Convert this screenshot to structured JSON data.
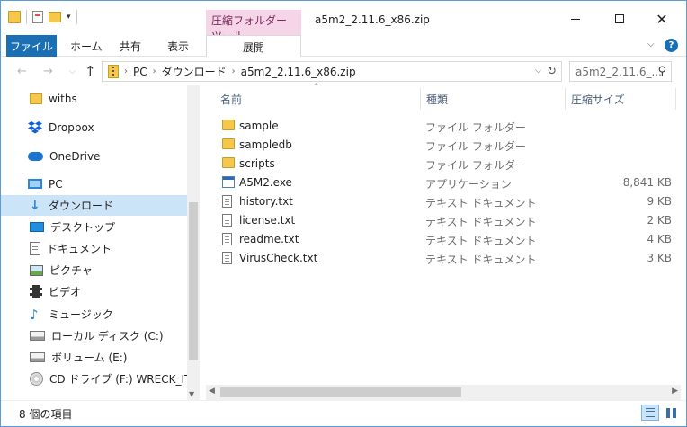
{
  "window": {
    "title": "a5m2_2.11.6_x86.zip",
    "context_tab_group": "圧縮フォルダー ツール",
    "controls": {
      "minimize": "–",
      "maximize": "□",
      "close": "✕"
    }
  },
  "ribbon": {
    "tabs": [
      {
        "label": "ファイル"
      },
      {
        "label": "ホーム"
      },
      {
        "label": "共有"
      },
      {
        "label": "表示"
      },
      {
        "label": "展開"
      }
    ],
    "collapse_glyph": "⌵",
    "help_glyph": "?"
  },
  "nav": {
    "back_glyph": "←",
    "forward_glyph": "→",
    "recent_glyph": "⌵",
    "up_glyph": "↑",
    "breadcrumb": [
      "PC",
      "ダウンロード",
      "a5m2_2.11.6_x86.zip"
    ],
    "crumb_separator": "›",
    "address_drop_glyph": "⌵",
    "refresh_glyph": "↻",
    "search_placeholder": "a5m2_2.11.6_...",
    "search_glyph": "⚲"
  },
  "sidebar": {
    "items": [
      {
        "label": "withs",
        "icon": "folder-icon",
        "root": false,
        "selected": false
      },
      {
        "label": "Dropbox",
        "icon": "dropbox-icon",
        "root": true,
        "selected": false
      },
      {
        "label": "OneDrive",
        "icon": "onedrive-icon",
        "root": true,
        "selected": false
      },
      {
        "label": "PC",
        "icon": "pc-icon",
        "root": true,
        "selected": false
      },
      {
        "label": "ダウンロード",
        "icon": "download-icon",
        "root": false,
        "selected": true
      },
      {
        "label": "デスクトップ",
        "icon": "desktop-icon",
        "root": false,
        "selected": false
      },
      {
        "label": "ドキュメント",
        "icon": "document-icon",
        "root": false,
        "selected": false
      },
      {
        "label": "ピクチャ",
        "icon": "pictures-icon",
        "root": false,
        "selected": false
      },
      {
        "label": "ビデオ",
        "icon": "video-icon",
        "root": false,
        "selected": false
      },
      {
        "label": "ミュージック",
        "icon": "music-icon",
        "root": false,
        "selected": false
      },
      {
        "label": "ローカル ディスク (C:)",
        "icon": "drive-icon",
        "root": false,
        "selected": false
      },
      {
        "label": "ボリューム (E:)",
        "icon": "drive-icon",
        "root": false,
        "selected": false
      },
      {
        "label": "CD ドライブ (F:) WRECK_IT_RA",
        "icon": "cd-drive-icon",
        "root": false,
        "selected": false
      }
    ],
    "scroll_down_glyph": "▼"
  },
  "file_list": {
    "columns": {
      "name": "名前",
      "type": "種類",
      "size": "圧縮サイズ"
    },
    "sort_glyph": "^",
    "rows": [
      {
        "name": "sample",
        "type": "ファイル フォルダー",
        "size": "",
        "icon": "folder-icon"
      },
      {
        "name": "sampledb",
        "type": "ファイル フォルダー",
        "size": "",
        "icon": "folder-icon"
      },
      {
        "name": "scripts",
        "type": "ファイル フォルダー",
        "size": "",
        "icon": "folder-icon"
      },
      {
        "name": "A5M2.exe",
        "type": "アプリケーション",
        "size": "8,841 KB",
        "icon": "exe-icon"
      },
      {
        "name": "history.txt",
        "type": "テキスト ドキュメント",
        "size": "9 KB",
        "icon": "text-file-icon"
      },
      {
        "name": "license.txt",
        "type": "テキスト ドキュメント",
        "size": "2 KB",
        "icon": "text-file-icon"
      },
      {
        "name": "readme.txt",
        "type": "テキスト ドキュメント",
        "size": "4 KB",
        "icon": "text-file-icon"
      },
      {
        "name": "VirusCheck.txt",
        "type": "テキスト ドキュメント",
        "size": "3 KB",
        "icon": "text-file-icon"
      }
    ],
    "scroll_left_glyph": "◀",
    "scroll_right_glyph": "▶"
  },
  "status": {
    "item_count": "8 個の項目"
  },
  "colors": {
    "accent": "#1a6fb5",
    "context_tab": "#f7d5e9",
    "selection": "#cce4f7",
    "folder": "#f5c84c"
  }
}
